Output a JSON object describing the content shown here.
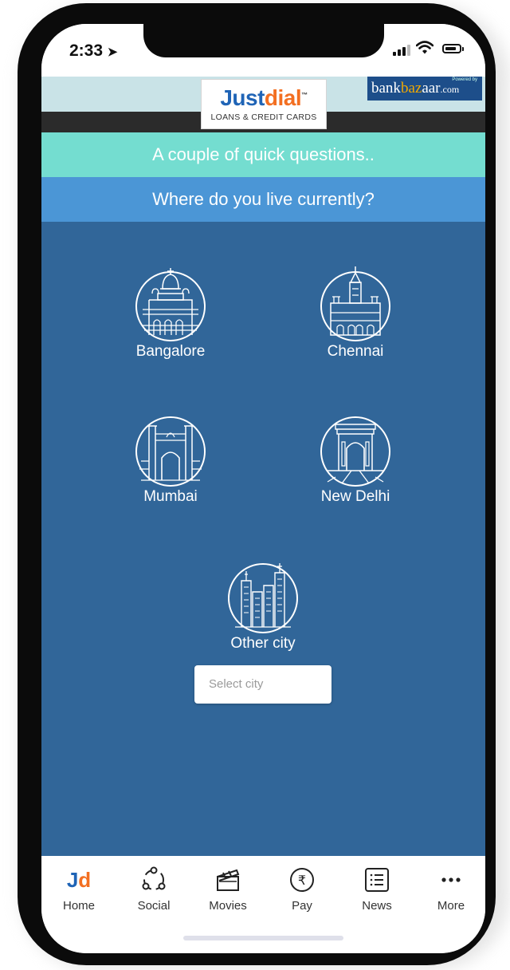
{
  "status_bar": {
    "time": "2:33"
  },
  "banner": {
    "logo_just": "Just",
    "logo_dial": "dial",
    "logo_sub": "LOANS & CREDIT CARDS",
    "partner_powered": "Powered by",
    "partner_bank": "bank",
    "partner_bazaar": "ba",
    "partner_bazaar2": "z",
    "partner_bazaar3": "aar",
    "partner_com": ".com"
  },
  "questions": {
    "heading": "A couple of quick questions..",
    "prompt": "Where do you live currently?"
  },
  "cities": {
    "bangalore": "Bangalore",
    "chennai": "Chennai",
    "mumbai": "Mumbai",
    "new_delhi": "New Delhi",
    "other": "Other city"
  },
  "select_city": {
    "placeholder": "Select city"
  },
  "tabs": {
    "home": "Home",
    "social": "Social",
    "movies": "Movies",
    "pay": "Pay",
    "news": "News",
    "more": "More",
    "home_logo_j": "J",
    "home_logo_d": "d"
  },
  "colors": {
    "main_bg": "#316699",
    "question_teal": "#74ddd0",
    "question_blue": "#4b96d6",
    "justdial_blue": "#1f64b6",
    "justdial_orange": "#f36f21"
  }
}
